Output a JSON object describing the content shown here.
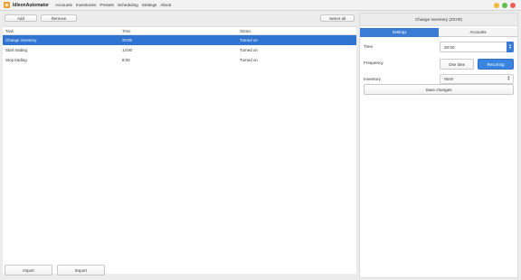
{
  "app": {
    "name": "IdleonAutomator"
  },
  "menu": [
    "Accounts",
    "Inventories",
    "Presets",
    "Scheduling",
    "Settings",
    "About"
  ],
  "toolbar": {
    "add": "Add",
    "remove": "Remove",
    "select_all": "Select all"
  },
  "table": {
    "columns": [
      "Task",
      "Time",
      "Status"
    ],
    "rows": [
      {
        "task": "Change inventory",
        "time": "20:00",
        "status": "Turned on"
      },
      {
        "task": "Start trading",
        "time": "14:00",
        "status": "Turned on"
      },
      {
        "task": "Stop trading",
        "time": "8:00",
        "status": "Turned on"
      }
    ],
    "selected_index": 0
  },
  "footer": {
    "import": "Import",
    "export": "Export"
  },
  "panel": {
    "title": "Change inventory (20:00)",
    "tabs": [
      "Settings",
      "Accounts"
    ],
    "active_tab": 0,
    "time_label": "Time",
    "time_value": "20:00",
    "frequency_label": "Frequency",
    "one_time": "One time",
    "recurring": "Recurring",
    "inventory_label": "Inventory",
    "inventory_value": "NEW",
    "save": "Save changes"
  },
  "colors": {
    "accent": "#3a7bd5",
    "selection": "#2f74d0"
  }
}
